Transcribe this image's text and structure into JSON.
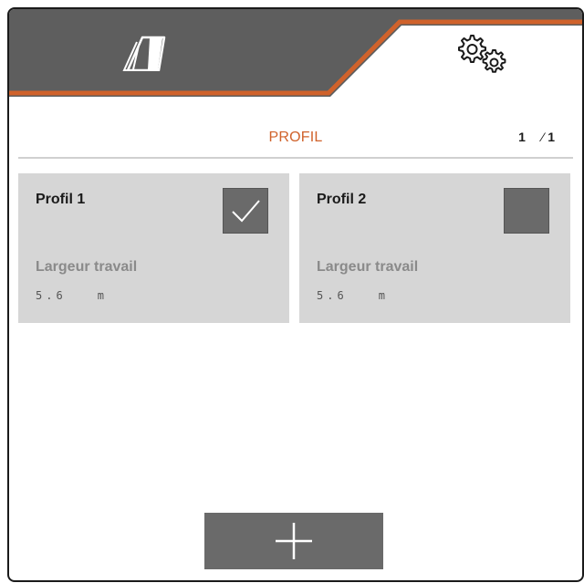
{
  "tabs": [
    {
      "icon": "machine-icon",
      "active": false
    },
    {
      "icon": "gears-icon",
      "active": true
    }
  ],
  "header": {
    "title": "PROFIL",
    "page_current": "1",
    "page_sep": "⁄",
    "page_total": "1"
  },
  "profiles": [
    {
      "name": "Profil 1",
      "selected": true,
      "label": "Largeur travail",
      "value": "5.6",
      "unit": "m"
    },
    {
      "name": "Profil 2",
      "selected": false,
      "label": "Largeur travail",
      "value": "5.6",
      "unit": "m"
    }
  ],
  "footer": {
    "add_icon": "plus-icon"
  },
  "colors": {
    "tabbar_dark": "#5e5e5e",
    "accent": "#d0622b",
    "card_bg": "#d6d6d6",
    "button_bg": "#6a6a6a",
    "checkbox_bg": "#6a6a6a",
    "title": "#d0622b"
  }
}
